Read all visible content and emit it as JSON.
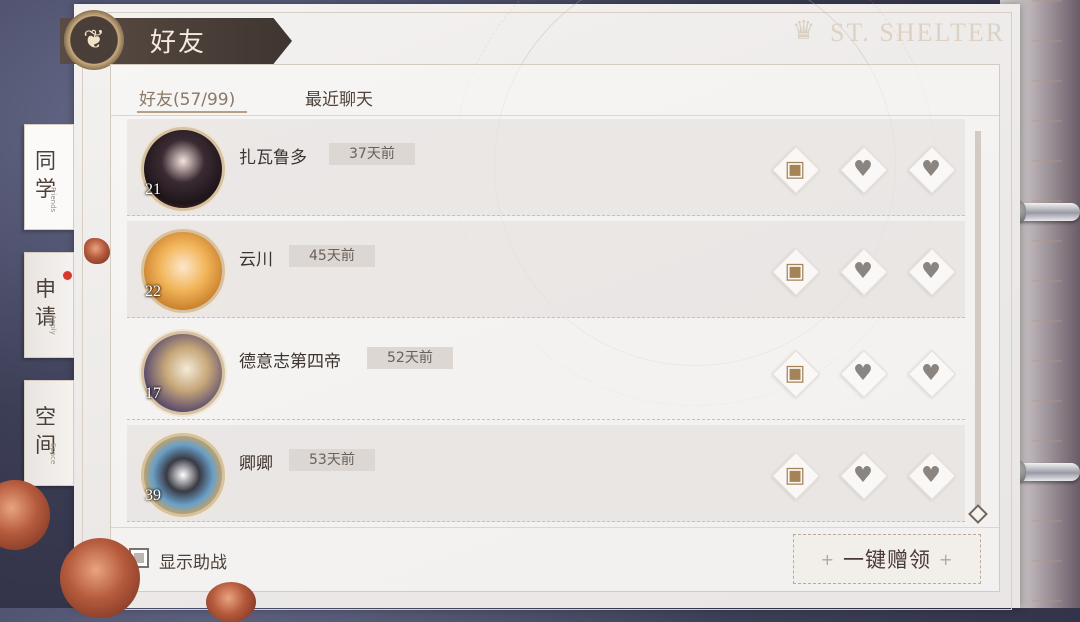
{
  "title": "好友",
  "brand": "ST. SHELTER",
  "side_tabs": [
    {
      "label": "同学",
      "sub": "Friends",
      "active": true
    },
    {
      "label": "申请",
      "sub": "Apply",
      "notify": true
    },
    {
      "label": "空间",
      "sub": "Space"
    }
  ],
  "tabs": {
    "friends": "好友(57/99)",
    "recent": "最近聊天"
  },
  "friends": [
    {
      "name": "扎瓦鲁多",
      "last_online": "37天前",
      "level": "21"
    },
    {
      "name": "云川",
      "last_online": "45天前",
      "level": "22"
    },
    {
      "name": "德意志第四帝",
      "last_online": "52天前",
      "level": "17"
    },
    {
      "name": "卿卿",
      "last_online": "53天前",
      "level": "39"
    }
  ],
  "actions": {
    "chat_icon": "chat-bubble-icon",
    "send_icon": "heart-send-icon",
    "receive_icon": "heart-check-icon"
  },
  "bottom": {
    "show_support": "显示助战",
    "claim_all": "一键赠领"
  },
  "colors": {
    "accent": "#b59f86",
    "banner": "#4a3e38",
    "notify": "#d73a2c"
  }
}
